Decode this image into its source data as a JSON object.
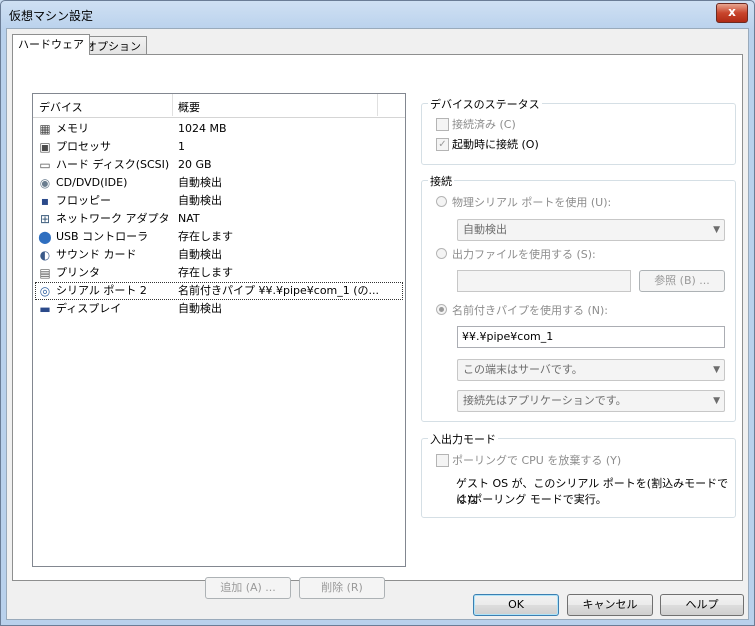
{
  "window": {
    "title": "仮想マシン設定",
    "close_glyph": "x"
  },
  "tabs": [
    {
      "label": "ハードウェア",
      "active": true
    },
    {
      "label": "オプション",
      "active": false
    }
  ],
  "device_list": {
    "col_device": "デバイス",
    "col_summary": "概要",
    "rows": [
      {
        "name": "メモリ",
        "summary": "1024 MB",
        "icon": "memory-icon",
        "glyph": "▦",
        "color": "#4b4b4b"
      },
      {
        "name": "プロセッサ",
        "summary": "1",
        "icon": "processor-icon",
        "glyph": "▣",
        "color": "#4b4b4b"
      },
      {
        "name": "ハード ディスク(SCSI)",
        "summary": "20 GB",
        "icon": "hard-disk-icon",
        "glyph": "▭",
        "color": "#555555"
      },
      {
        "name": "CD/DVD(IDE)",
        "summary": "自動検出",
        "icon": "cd-dvd-icon",
        "glyph": "◉",
        "color": "#6a7d8f"
      },
      {
        "name": "フロッピー",
        "summary": "自動検出",
        "icon": "floppy-icon",
        "glyph": "▪",
        "color": "#2b4a8a"
      },
      {
        "name": "ネットワーク アダプタ",
        "summary": "NAT",
        "icon": "network-adapter-icon",
        "glyph": "⊞",
        "color": "#3b5b7b"
      },
      {
        "name": "USB コントローラ",
        "summary": "存在します",
        "icon": "usb-icon",
        "glyph": "⬤",
        "color": "#2f6fc0"
      },
      {
        "name": "サウンド カード",
        "summary": "自動検出",
        "icon": "sound-card-icon",
        "glyph": "◐",
        "color": "#3a5a8a"
      },
      {
        "name": "プリンタ",
        "summary": "存在します",
        "icon": "printer-icon",
        "glyph": "▤",
        "color": "#5a5a5a"
      },
      {
        "name": "シリアル ポート 2",
        "summary": "名前付きパイプ ¥¥.¥pipe¥com_1 (の...",
        "icon": "serial-port-icon",
        "glyph": "◎",
        "color": "#2f5fa0",
        "selected": true
      },
      {
        "name": "ディスプレイ",
        "summary": "自動検出",
        "icon": "display-icon",
        "glyph": "▬",
        "color": "#2b4a8a"
      }
    ],
    "add_button": "追加 (A) ...",
    "remove_button": "削除 (R)"
  },
  "device_status": {
    "title": "デバイスのステータス",
    "connected": {
      "label": "接続済み (C)",
      "checked": false
    },
    "connect_at_power_on": {
      "label": "起動時に接続 (O)",
      "checked": true
    }
  },
  "connection": {
    "title": "接続",
    "physical": {
      "label": "物理シリアル ポートを使用 (U):",
      "selected": false,
      "combo": "自動検出"
    },
    "output_file": {
      "label": "出力ファイルを使用する (S):",
      "selected": false,
      "value": "",
      "browse": "参照 (B) ..."
    },
    "named_pipe": {
      "label": "名前付きパイプを使用する (N):",
      "selected": true,
      "value": "¥¥.¥pipe¥com_1",
      "end_combo": "この端末はサーバです。",
      "other_combo": "接続先はアプリケーションです。"
    }
  },
  "io_mode": {
    "title": "入出力モード",
    "polling": {
      "label": "ポーリングで CPU を放棄する (Y)",
      "checked": false
    },
    "description_line1": "ゲスト OS が、このシリアル ポートを(割込みモードではな",
    "description_line2": "く)ポーリング モードで実行。"
  },
  "footer": {
    "ok": "OK",
    "cancel": "キャンセル",
    "help": "ヘルプ"
  },
  "colors": {
    "title_bar": "#b9d1ec",
    "dialog_bg": "#f0f0f0",
    "close_button": "#c8452c"
  }
}
